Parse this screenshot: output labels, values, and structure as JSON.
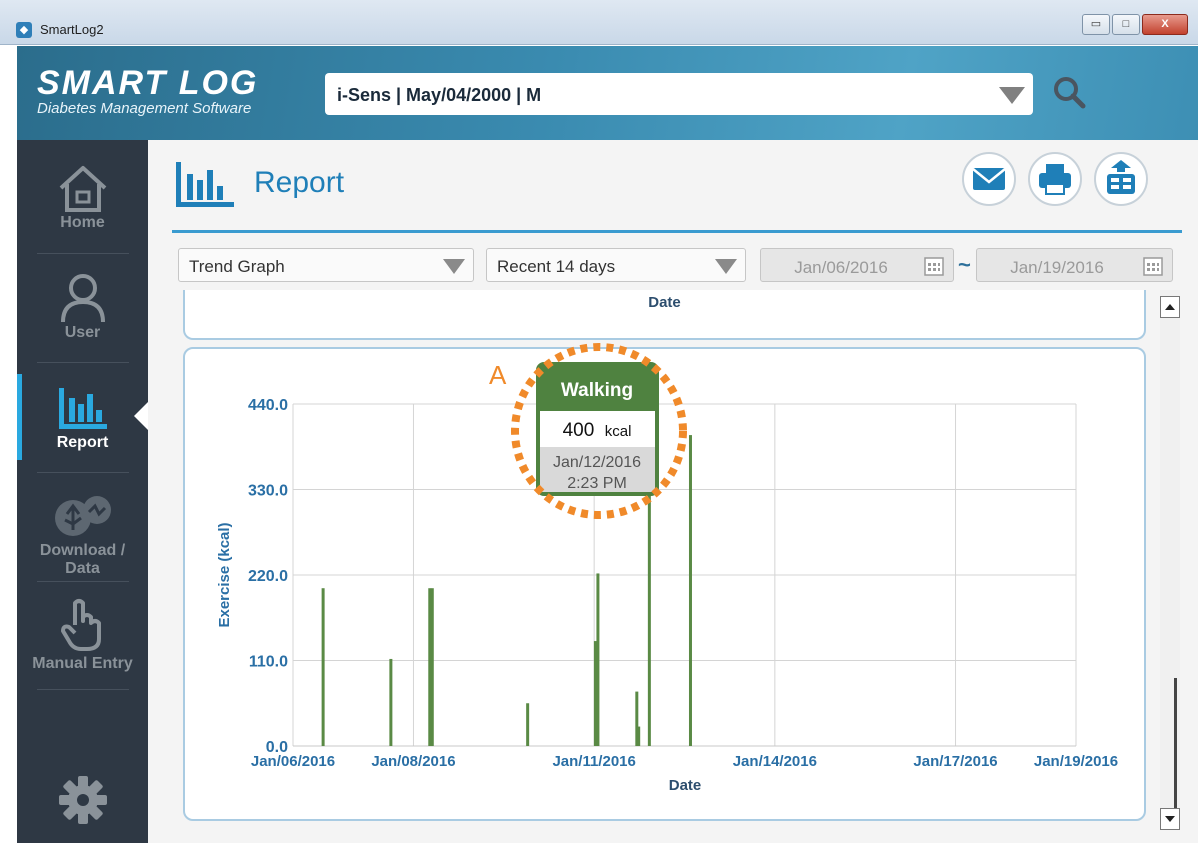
{
  "window": {
    "title": "SmartLog2",
    "minimize": "▭",
    "maximize": "□",
    "close": "X"
  },
  "header": {
    "logo": "SMART LOG",
    "subtitle": "Diabetes Management Software",
    "user_select": "i-Sens | May/04/2000 | M"
  },
  "sidebar": {
    "items": [
      {
        "label": "Home",
        "icon": "home-icon"
      },
      {
        "label": "User",
        "icon": "user-icon"
      },
      {
        "label": "Report",
        "icon": "report-icon",
        "active": true
      },
      {
        "label": "Download /",
        "label2": "Data",
        "icon": "usb-download-icon"
      },
      {
        "label": "Manual Entry",
        "icon": "hand-pointer-icon"
      },
      {
        "label": "",
        "icon": "gear-icon"
      }
    ]
  },
  "report": {
    "title": "Report",
    "graph_type": "Trend Graph",
    "range": "Recent 14 days",
    "date_from": "Jan/06/2016",
    "date_sep": "~",
    "date_to": "Jan/19/2016",
    "top_panel_label": "Date"
  },
  "annotation": {
    "marker": "A"
  },
  "tooltip": {
    "title": "Walking",
    "value": "400",
    "unit": "kcal",
    "date": "Jan/12/2016",
    "time": "2:23 PM"
  },
  "colors": {
    "bar": "#5a8a45",
    "axis_text": "#2a6fa5",
    "tooltip_header": "#4f8240",
    "highlight": "#f08a2a"
  },
  "chart_data": {
    "type": "bar",
    "xlabel": "Date",
    "ylabel": "Exercise (kcal)",
    "ylim": [
      0,
      440
    ],
    "yticks": [
      "0.0",
      "110.0",
      "220.0",
      "330.0",
      "440.0"
    ],
    "xlim_days": [
      0,
      13
    ],
    "xticks": [
      "Jan/06/2016",
      "Jan/08/2016",
      "Jan/11/2016",
      "Jan/14/2016",
      "Jan/17/2016",
      "Jan/19/2016"
    ],
    "grid": true,
    "series": [
      {
        "points": [
          {
            "date": "Jan/06/2016 12:00",
            "value": 203
          },
          {
            "date": "Jan/07/2016 15:00",
            "value": 112
          },
          {
            "date": "Jan/08/2016 06:30",
            "value": 203
          },
          {
            "date": "Jan/08/2016 07:30",
            "value": 203
          },
          {
            "date": "Jan/09/2016 21:30",
            "value": 55
          },
          {
            "date": "Jan/11/2016 00:30",
            "value": 135
          },
          {
            "date": "Jan/11/2016 01:30",
            "value": 222
          },
          {
            "date": "Jan/11/2016 17:00",
            "value": 70
          },
          {
            "date": "Jan/11/2016 17:45",
            "value": 25
          },
          {
            "date": "Jan/11/2016 22:00",
            "value": 400
          },
          {
            "date": "Jan/12/2016 14:23",
            "value": 400
          }
        ]
      }
    ]
  }
}
